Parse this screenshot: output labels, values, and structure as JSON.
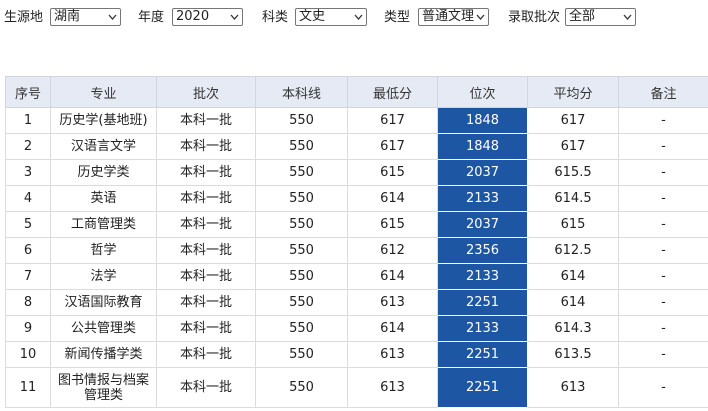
{
  "filters": {
    "origin_label": "生源地",
    "origin_value": "湖南",
    "year_label": "年度",
    "year_value": "2020",
    "subject_label": "科类",
    "subject_value": "文史",
    "type_label": "类型",
    "type_value": "普通文理",
    "batch_label": "录取批次",
    "batch_value": "全部"
  },
  "table": {
    "columns": [
      "序号",
      "专业",
      "批次",
      "本科线",
      "最低分",
      "位次",
      "平均分",
      "备注"
    ],
    "rows": [
      [
        "1",
        "历史学(基地班)",
        "本科一批",
        "550",
        "617",
        "1848",
        "617",
        "-"
      ],
      [
        "2",
        "汉语言文学",
        "本科一批",
        "550",
        "617",
        "1848",
        "617",
        "-"
      ],
      [
        "3",
        "历史学类",
        "本科一批",
        "550",
        "615",
        "2037",
        "615.5",
        "-"
      ],
      [
        "4",
        "英语",
        "本科一批",
        "550",
        "614",
        "2133",
        "614.5",
        "-"
      ],
      [
        "5",
        "工商管理类",
        "本科一批",
        "550",
        "615",
        "2037",
        "615",
        "-"
      ],
      [
        "6",
        "哲学",
        "本科一批",
        "550",
        "612",
        "2356",
        "612.5",
        "-"
      ],
      [
        "7",
        "法学",
        "本科一批",
        "550",
        "614",
        "2133",
        "614",
        "-"
      ],
      [
        "8",
        "汉语国际教育",
        "本科一批",
        "550",
        "613",
        "2251",
        "614",
        "-"
      ],
      [
        "9",
        "公共管理类",
        "本科一批",
        "550",
        "614",
        "2133",
        "614.3",
        "-"
      ],
      [
        "10",
        "新闻传播学类",
        "本科一批",
        "550",
        "613",
        "2251",
        "613.5",
        "-"
      ],
      [
        "11",
        "图书情报与档案管理类",
        "本科一批",
        "550",
        "613",
        "2251",
        "613",
        "-"
      ]
    ]
  },
  "colors": {
    "header_bg": "#e6eaf4",
    "rank_bg": "#1d56a3"
  }
}
